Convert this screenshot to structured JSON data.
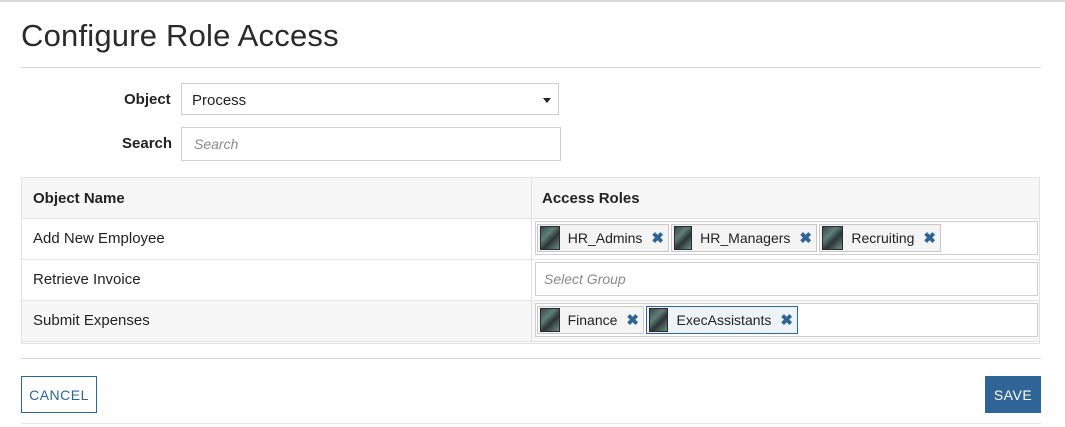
{
  "page": {
    "title": "Configure Role Access"
  },
  "form": {
    "object_label": "Object",
    "object_value": "Process",
    "search_label": "Search",
    "search_placeholder": "Search"
  },
  "table": {
    "headers": {
      "name": "Object Name",
      "roles": "Access Roles"
    },
    "rows": [
      {
        "name": "Add New Employee",
        "roles": [
          "HR_Admins",
          "HR_Managers",
          "Recruiting"
        ]
      },
      {
        "name": "Retrieve Invoice",
        "roles": [],
        "placeholder": "Select Group"
      },
      {
        "name": "Submit Expenses",
        "roles": [
          "Finance",
          "ExecAssistants"
        ]
      }
    ]
  },
  "icons": {
    "tag_remove": "close-icon",
    "dropdown": "chevron-down-icon",
    "role_avatar": "group-avatar-icon"
  },
  "buttons": {
    "cancel": "CANCEL",
    "save": "SAVE"
  },
  "colors": {
    "accent": "#2f6496",
    "border": "#cfcfcf",
    "row_alt": "#f7f7f7"
  }
}
